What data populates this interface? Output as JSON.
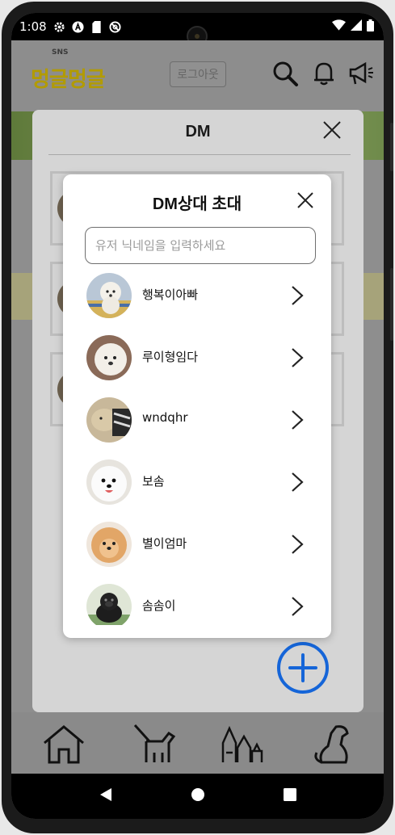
{
  "status_bar": {
    "time": "1:08",
    "icons": [
      "gear-icon",
      "a-badge-icon",
      "sd-card-icon",
      "blocked-icon"
    ],
    "right_icons": [
      "wifi-icon",
      "signal-icon",
      "battery-icon"
    ]
  },
  "app": {
    "logo": "멍글멍글",
    "logo_badge": "SNS",
    "logout_label": "로그아웃",
    "header_icons": [
      "search-icon",
      "bell-icon",
      "megaphone-icon"
    ],
    "colors": {
      "logo": "#b29b00",
      "accent": "#1565d8"
    }
  },
  "dm": {
    "title": "DM",
    "cards": 3
  },
  "invite_modal": {
    "title": "DM상대 초대",
    "search_placeholder": "유저 닉네임을 입력하세요",
    "search_value": "",
    "users": [
      {
        "name": "행복이아빠"
      },
      {
        "name": "루이형임다"
      },
      {
        "name": "wndqhr"
      },
      {
        "name": "보솜"
      },
      {
        "name": "별이엄마"
      },
      {
        "name": "솜솜이"
      }
    ]
  },
  "bottom_nav": [
    "home-icon",
    "guide-dog-icon",
    "dog-group-icon",
    "dog-sitting-icon"
  ],
  "system_nav": [
    "back-icon",
    "home-circle-icon",
    "recents-icon"
  ]
}
